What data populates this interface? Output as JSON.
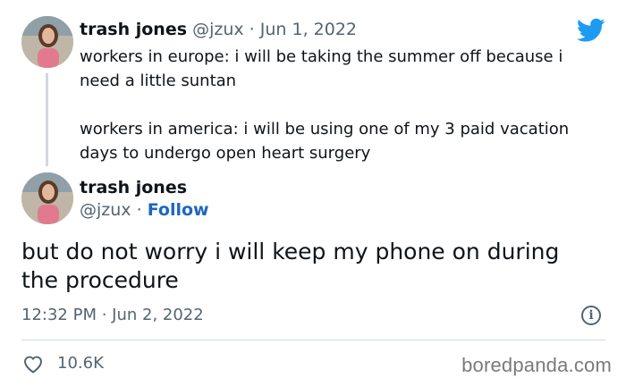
{
  "tweet_1": {
    "name": "trash jones",
    "handle": "@jzux",
    "separator": "·",
    "date": "Jun 1, 2022",
    "paragraph_1": "workers in europe: i will be taking the summer off because i need a little suntan",
    "paragraph_2": "workers in america: i will be using one of my 3 paid vacation days to undergo open heart surgery"
  },
  "tweet_2": {
    "name": "trash jones",
    "handle": "@jzux",
    "separator": "·",
    "follow_label": "Follow",
    "text": "but do not worry i will keep my phone on during the procedure",
    "timestamp": "12:32 PM · Jun 2, 2022",
    "likes": "10.6K"
  },
  "icons": {
    "brand": "twitter-bird-icon",
    "info": "info-icon",
    "like": "heart-icon"
  },
  "colors": {
    "brand_blue": "#1d9bf0",
    "follow_blue": "#1d66c1",
    "muted": "#536471"
  },
  "watermark": "boredpanda.com"
}
